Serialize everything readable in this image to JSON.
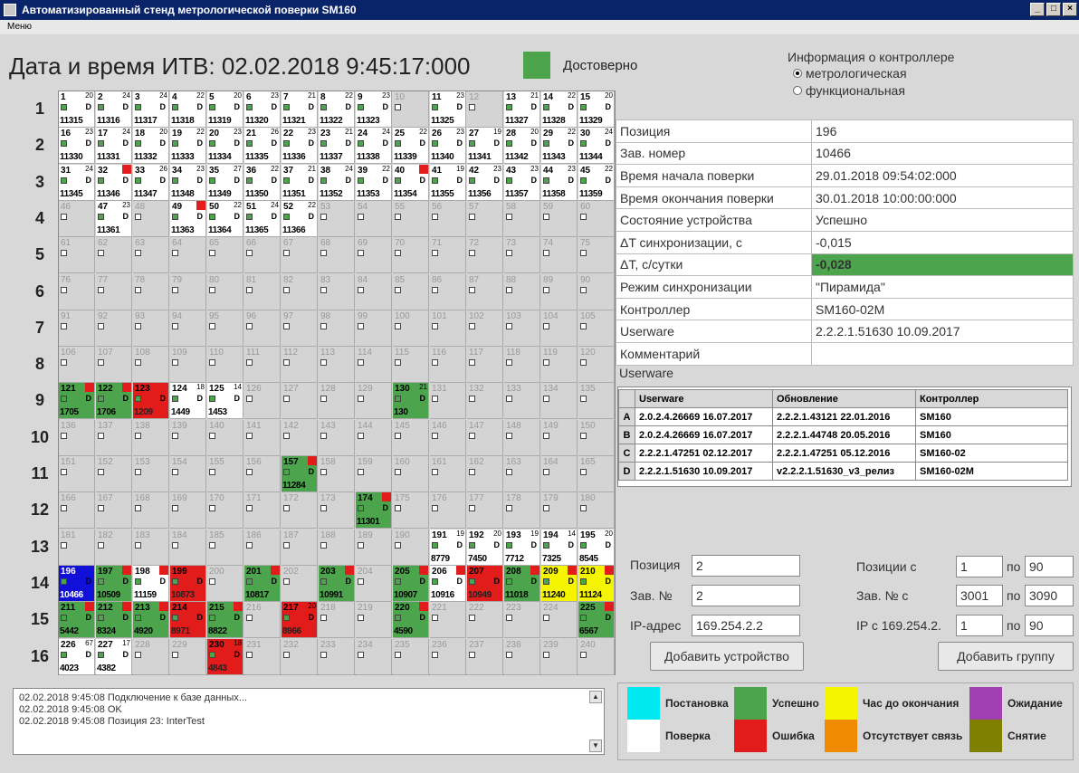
{
  "window": {
    "title": "Автоматизированный стенд метрологической поверки SM160",
    "buttons": [
      "_",
      "□",
      "×"
    ]
  },
  "menu": {
    "label": "Меню"
  },
  "header": {
    "datetime": "Дата и время ИТВ: 02.02.2018 9:45:17:000",
    "reliability": "Достоверно",
    "reliability_color": "#4ca44c"
  },
  "controller_info": {
    "title": "Информация о контроллере",
    "options": [
      {
        "label": "метрологическая",
        "selected": true
      },
      {
        "label": "функциональная",
        "selected": false
      }
    ]
  },
  "rows": [
    "1",
    "2",
    "3",
    "4",
    "5",
    "6",
    "7",
    "8",
    "9",
    "10",
    "11",
    "12",
    "13",
    "14",
    "15",
    "16"
  ],
  "cells": [
    {
      "n": "1",
      "c": "w",
      "s": "11315",
      "t": "20"
    },
    {
      "n": "2",
      "c": "w",
      "s": "11316",
      "t": "24"
    },
    {
      "n": "3",
      "c": "w",
      "s": "11317",
      "t": "24"
    },
    {
      "n": "4",
      "c": "w",
      "s": "11318",
      "t": "22"
    },
    {
      "n": "5",
      "c": "w",
      "s": "11319",
      "t": "20"
    },
    {
      "n": "6",
      "c": "w",
      "s": "11320",
      "t": "23"
    },
    {
      "n": "7",
      "c": "w",
      "s": "11321",
      "t": "21"
    },
    {
      "n": "8",
      "c": "w",
      "s": "11322",
      "t": "22"
    },
    {
      "n": "9",
      "c": "w",
      "s": "11323",
      "t": "23"
    },
    {
      "n": "10",
      "c": "e"
    },
    {
      "n": "11",
      "c": "w",
      "s": "11325",
      "t": "23"
    },
    {
      "n": "12",
      "c": "e"
    },
    {
      "n": "13",
      "c": "w",
      "s": "11327",
      "t": "21"
    },
    {
      "n": "14",
      "c": "w",
      "s": "11328",
      "t": "22"
    },
    {
      "n": "15",
      "c": "w",
      "s": "11329",
      "t": "20"
    },
    {
      "n": "16",
      "c": "w",
      "s": "11330",
      "t": "23"
    },
    {
      "n": "17",
      "c": "w",
      "s": "11331",
      "t": "24"
    },
    {
      "n": "18",
      "c": "w",
      "s": "11332",
      "t": "20"
    },
    {
      "n": "19",
      "c": "w",
      "s": "11333",
      "t": "22"
    },
    {
      "n": "20",
      "c": "w",
      "s": "11334",
      "t": "23"
    },
    {
      "n": "21",
      "c": "w",
      "s": "11335",
      "t": "26"
    },
    {
      "n": "22",
      "c": "w",
      "s": "11336",
      "t": "23"
    },
    {
      "n": "23",
      "c": "w",
      "s": "11337",
      "t": "21"
    },
    {
      "n": "24",
      "c": "w",
      "s": "11338",
      "t": "24"
    },
    {
      "n": "25",
      "c": "w",
      "s": "11339",
      "t": "22"
    },
    {
      "n": "26",
      "c": "w",
      "s": "11340",
      "t": "23"
    },
    {
      "n": "27",
      "c": "w",
      "s": "11341",
      "t": "19"
    },
    {
      "n": "28",
      "c": "w",
      "s": "11342",
      "t": "20"
    },
    {
      "n": "29",
      "c": "w",
      "s": "11343",
      "t": "22"
    },
    {
      "n": "30",
      "c": "w",
      "s": "11344",
      "t": "24"
    },
    {
      "n": "31",
      "c": "w",
      "s": "11345",
      "t": "24"
    },
    {
      "n": "32",
      "c": "w",
      "s": "11346",
      "t": "",
      "f": "r"
    },
    {
      "n": "33",
      "c": "w",
      "s": "11347",
      "t": "26"
    },
    {
      "n": "34",
      "c": "w",
      "s": "11348",
      "t": "23"
    },
    {
      "n": "35",
      "c": "w",
      "s": "11349",
      "t": "27"
    },
    {
      "n": "36",
      "c": "w",
      "s": "11350",
      "t": "22"
    },
    {
      "n": "37",
      "c": "w",
      "s": "11351",
      "t": "21"
    },
    {
      "n": "38",
      "c": "w",
      "s": "11352",
      "t": "24"
    },
    {
      "n": "39",
      "c": "w",
      "s": "11353",
      "t": "22"
    },
    {
      "n": "40",
      "c": "w",
      "s": "11354",
      "t": "",
      "f": "r"
    },
    {
      "n": "41",
      "c": "w",
      "s": "11355",
      "t": "19"
    },
    {
      "n": "42",
      "c": "w",
      "s": "11356",
      "t": "23"
    },
    {
      "n": "43",
      "c": "w",
      "s": "11357",
      "t": "23"
    },
    {
      "n": "44",
      "c": "w",
      "s": "11358",
      "t": "23"
    },
    {
      "n": "45",
      "c": "w",
      "s": "11359",
      "t": "22"
    },
    {
      "n": "46",
      "c": "e"
    },
    {
      "n": "47",
      "c": "w",
      "s": "11361",
      "t": "23"
    },
    {
      "n": "48",
      "c": "e"
    },
    {
      "n": "49",
      "c": "w",
      "s": "11363",
      "t": "",
      "f": "r"
    },
    {
      "n": "50",
      "c": "w",
      "s": "11364",
      "t": "22"
    },
    {
      "n": "51",
      "c": "w",
      "s": "11365",
      "t": "24"
    },
    {
      "n": "52",
      "c": "w",
      "s": "11366",
      "t": "22"
    },
    {
      "n": "53",
      "c": "e"
    },
    {
      "n": "54",
      "c": "e"
    },
    {
      "n": "55",
      "c": "e"
    },
    {
      "n": "56",
      "c": "e"
    },
    {
      "n": "57",
      "c": "e"
    },
    {
      "n": "58",
      "c": "e"
    },
    {
      "n": "59",
      "c": "e"
    },
    {
      "n": "60",
      "c": "e"
    },
    {
      "n": "61",
      "c": "e"
    },
    {
      "n": "62",
      "c": "e"
    },
    {
      "n": "63",
      "c": "e"
    },
    {
      "n": "64",
      "c": "e"
    },
    {
      "n": "65",
      "c": "e"
    },
    {
      "n": "66",
      "c": "e"
    },
    {
      "n": "67",
      "c": "e"
    },
    {
      "n": "68",
      "c": "e"
    },
    {
      "n": "69",
      "c": "e"
    },
    {
      "n": "70",
      "c": "e"
    },
    {
      "n": "71",
      "c": "e"
    },
    {
      "n": "72",
      "c": "e"
    },
    {
      "n": "73",
      "c": "e"
    },
    {
      "n": "74",
      "c": "e"
    },
    {
      "n": "75",
      "c": "e"
    },
    {
      "n": "76",
      "c": "e"
    },
    {
      "n": "77",
      "c": "e"
    },
    {
      "n": "78",
      "c": "e"
    },
    {
      "n": "79",
      "c": "e"
    },
    {
      "n": "80",
      "c": "e"
    },
    {
      "n": "81",
      "c": "e"
    },
    {
      "n": "82",
      "c": "e"
    },
    {
      "n": "83",
      "c": "e"
    },
    {
      "n": "84",
      "c": "e"
    },
    {
      "n": "85",
      "c": "e"
    },
    {
      "n": "86",
      "c": "e"
    },
    {
      "n": "87",
      "c": "e"
    },
    {
      "n": "88",
      "c": "e"
    },
    {
      "n": "89",
      "c": "e"
    },
    {
      "n": "90",
      "c": "e"
    },
    {
      "n": "91",
      "c": "e"
    },
    {
      "n": "92",
      "c": "e"
    },
    {
      "n": "93",
      "c": "e"
    },
    {
      "n": "94",
      "c": "e"
    },
    {
      "n": "95",
      "c": "e"
    },
    {
      "n": "96",
      "c": "e"
    },
    {
      "n": "97",
      "c": "e"
    },
    {
      "n": "98",
      "c": "e"
    },
    {
      "n": "99",
      "c": "e"
    },
    {
      "n": "100",
      "c": "e"
    },
    {
      "n": "101",
      "c": "e"
    },
    {
      "n": "102",
      "c": "e"
    },
    {
      "n": "103",
      "c": "e"
    },
    {
      "n": "104",
      "c": "e"
    },
    {
      "n": "105",
      "c": "e"
    },
    {
      "n": "106",
      "c": "e"
    },
    {
      "n": "107",
      "c": "e"
    },
    {
      "n": "108",
      "c": "e"
    },
    {
      "n": "109",
      "c": "e"
    },
    {
      "n": "110",
      "c": "e"
    },
    {
      "n": "111",
      "c": "e"
    },
    {
      "n": "112",
      "c": "e"
    },
    {
      "n": "113",
      "c": "e"
    },
    {
      "n": "114",
      "c": "e"
    },
    {
      "n": "115",
      "c": "e"
    },
    {
      "n": "116",
      "c": "e"
    },
    {
      "n": "117",
      "c": "e"
    },
    {
      "n": "118",
      "c": "e"
    },
    {
      "n": "119",
      "c": "e"
    },
    {
      "n": "120",
      "c": "e"
    },
    {
      "n": "121",
      "c": "g",
      "s": "1705",
      "f": "r"
    },
    {
      "n": "122",
      "c": "g",
      "s": "1706",
      "f": "r"
    },
    {
      "n": "123",
      "c": "r",
      "s": "1209",
      "f": "r"
    },
    {
      "n": "124",
      "c": "w",
      "s": "1449",
      "t": "18"
    },
    {
      "n": "125",
      "c": "w",
      "s": "1453",
      "t": "14"
    },
    {
      "n": "126",
      "c": "e"
    },
    {
      "n": "127",
      "c": "e"
    },
    {
      "n": "128",
      "c": "e"
    },
    {
      "n": "129",
      "c": "e"
    },
    {
      "n": "130",
      "c": "g",
      "s": "130",
      "t": "21"
    },
    {
      "n": "131",
      "c": "e"
    },
    {
      "n": "132",
      "c": "e"
    },
    {
      "n": "133",
      "c": "e"
    },
    {
      "n": "134",
      "c": "e"
    },
    {
      "n": "135",
      "c": "e"
    },
    {
      "n": "136",
      "c": "e"
    },
    {
      "n": "137",
      "c": "e"
    },
    {
      "n": "138",
      "c": "e"
    },
    {
      "n": "139",
      "c": "e"
    },
    {
      "n": "140",
      "c": "e"
    },
    {
      "n": "141",
      "c": "e"
    },
    {
      "n": "142",
      "c": "e"
    },
    {
      "n": "143",
      "c": "e"
    },
    {
      "n": "144",
      "c": "e"
    },
    {
      "n": "145",
      "c": "e"
    },
    {
      "n": "146",
      "c": "e"
    },
    {
      "n": "147",
      "c": "e"
    },
    {
      "n": "148",
      "c": "e"
    },
    {
      "n": "149",
      "c": "e"
    },
    {
      "n": "150",
      "c": "e"
    },
    {
      "n": "151",
      "c": "e"
    },
    {
      "n": "152",
      "c": "e"
    },
    {
      "n": "153",
      "c": "e"
    },
    {
      "n": "154",
      "c": "e"
    },
    {
      "n": "155",
      "c": "e"
    },
    {
      "n": "156",
      "c": "e"
    },
    {
      "n": "157",
      "c": "g",
      "s": "11284",
      "f": "r"
    },
    {
      "n": "158",
      "c": "e"
    },
    {
      "n": "159",
      "c": "e"
    },
    {
      "n": "160",
      "c": "e"
    },
    {
      "n": "161",
      "c": "e"
    },
    {
      "n": "162",
      "c": "e"
    },
    {
      "n": "163",
      "c": "e"
    },
    {
      "n": "164",
      "c": "e"
    },
    {
      "n": "165",
      "c": "e"
    },
    {
      "n": "166",
      "c": "e"
    },
    {
      "n": "167",
      "c": "e"
    },
    {
      "n": "168",
      "c": "e"
    },
    {
      "n": "169",
      "c": "e"
    },
    {
      "n": "170",
      "c": "e"
    },
    {
      "n": "171",
      "c": "e"
    },
    {
      "n": "172",
      "c": "e"
    },
    {
      "n": "173",
      "c": "e"
    },
    {
      "n": "174",
      "c": "g",
      "s": "11301",
      "f": "r"
    },
    {
      "n": "175",
      "c": "e"
    },
    {
      "n": "176",
      "c": "e"
    },
    {
      "n": "177",
      "c": "e"
    },
    {
      "n": "178",
      "c": "e"
    },
    {
      "n": "179",
      "c": "e"
    },
    {
      "n": "180",
      "c": "e"
    },
    {
      "n": "181",
      "c": "e"
    },
    {
      "n": "182",
      "c": "e"
    },
    {
      "n": "183",
      "c": "e"
    },
    {
      "n": "184",
      "c": "e"
    },
    {
      "n": "185",
      "c": "e"
    },
    {
      "n": "186",
      "c": "e"
    },
    {
      "n": "187",
      "c": "e"
    },
    {
      "n": "188",
      "c": "e"
    },
    {
      "n": "189",
      "c": "e"
    },
    {
      "n": "190",
      "c": "e"
    },
    {
      "n": "191",
      "c": "w",
      "s": "8779",
      "t": "19"
    },
    {
      "n": "192",
      "c": "w",
      "s": "7450",
      "t": "20"
    },
    {
      "n": "193",
      "c": "w",
      "s": "7712",
      "t": "19"
    },
    {
      "n": "194",
      "c": "w",
      "s": "7325",
      "t": "14"
    },
    {
      "n": "195",
      "c": "w",
      "s": "8545",
      "t": "20"
    },
    {
      "n": "196",
      "c": "b",
      "s": "10466"
    },
    {
      "n": "197",
      "c": "g",
      "s": "10509",
      "f": "r"
    },
    {
      "n": "198",
      "c": "w",
      "s": "11159",
      "f": "r"
    },
    {
      "n": "199",
      "c": "r",
      "s": "10873",
      "f": "r"
    },
    {
      "n": "200",
      "c": "e"
    },
    {
      "n": "201",
      "c": "g",
      "s": "10817",
      "f": "r"
    },
    {
      "n": "202",
      "c": "e"
    },
    {
      "n": "203",
      "c": "g",
      "s": "10991",
      "f": "r"
    },
    {
      "n": "204",
      "c": "e"
    },
    {
      "n": "205",
      "c": "g",
      "s": "10907",
      "f": "r"
    },
    {
      "n": "206",
      "c": "w",
      "s": "10916",
      "f": "r"
    },
    {
      "n": "207",
      "c": "r",
      "s": "10949",
      "f": "r"
    },
    {
      "n": "208",
      "c": "g",
      "s": "11018",
      "f": "r"
    },
    {
      "n": "209",
      "c": "y",
      "s": "11240",
      "f": "r"
    },
    {
      "n": "210",
      "c": "y",
      "s": "11124",
      "f": "r"
    },
    {
      "n": "211",
      "c": "g",
      "s": "5442",
      "f": "r"
    },
    {
      "n": "212",
      "c": "g",
      "s": "8324",
      "f": "r"
    },
    {
      "n": "213",
      "c": "g",
      "s": "4920",
      "f": "r"
    },
    {
      "n": "214",
      "c": "r",
      "s": "8971",
      "f": "r"
    },
    {
      "n": "215",
      "c": "g",
      "s": "8822",
      "f": "r"
    },
    {
      "n": "216",
      "c": "e"
    },
    {
      "n": "217",
      "c": "r",
      "s": "8966",
      "t": "20"
    },
    {
      "n": "218",
      "c": "e"
    },
    {
      "n": "219",
      "c": "e"
    },
    {
      "n": "220",
      "c": "g",
      "s": "4590",
      "f": "r"
    },
    {
      "n": "221",
      "c": "e"
    },
    {
      "n": "222",
      "c": "e"
    },
    {
      "n": "223",
      "c": "e"
    },
    {
      "n": "224",
      "c": "e"
    },
    {
      "n": "225",
      "c": "g",
      "s": "6567",
      "f": "r"
    },
    {
      "n": "226",
      "c": "w",
      "s": "4023",
      "t": "67"
    },
    {
      "n": "227",
      "c": "w",
      "s": "4382",
      "t": "17"
    },
    {
      "n": "228",
      "c": "e"
    },
    {
      "n": "229",
      "c": "e"
    },
    {
      "n": "230",
      "c": "r",
      "s": "4843",
      "t": "18"
    },
    {
      "n": "231",
      "c": "e"
    },
    {
      "n": "232",
      "c": "e"
    },
    {
      "n": "233",
      "c": "e"
    },
    {
      "n": "234",
      "c": "e"
    },
    {
      "n": "235",
      "c": "e"
    },
    {
      "n": "236",
      "c": "e"
    },
    {
      "n": "237",
      "c": "e"
    },
    {
      "n": "238",
      "c": "e"
    },
    {
      "n": "239",
      "c": "e"
    },
    {
      "n": "240",
      "c": "e"
    }
  ],
  "properties": [
    {
      "k": "Позиция",
      "v": "196"
    },
    {
      "k": "Зав. номер",
      "v": "10466"
    },
    {
      "k": "Время начала поверки",
      "v": "29.01.2018 09:54:02:000"
    },
    {
      "k": "Время окончания поверки",
      "v": "30.01.2018 10:00:00:000"
    },
    {
      "k": "Состояние устройства",
      "v": "Успешно"
    },
    {
      "k": "ΔT синхронизации, с",
      "v": "-0,015"
    },
    {
      "k": "ΔT, с/сутки",
      "v": "-0,028",
      "highlight": true
    },
    {
      "k": "Режим синхронизации",
      "v": "\"Пирамида\""
    },
    {
      "k": "Контроллер",
      "v": "SM160-02M"
    },
    {
      "k": "Userware",
      "v": "2.2.2.1.51630 10.09.2017"
    },
    {
      "k": "Комментарий",
      "v": ""
    }
  ],
  "userware": {
    "label": "Userware",
    "headers": [
      "Userware",
      "Обновление",
      "Контроллер"
    ],
    "rows": [
      {
        "r": "A",
        "uw": "2.0.2.4.26669 16.07.2017",
        "up": "2.2.2.1.43121 22.01.2016",
        "c": "SM160"
      },
      {
        "r": "B",
        "uw": "2.0.2.4.26669 16.07.2017",
        "up": "2.2.2.1.44748 20.05.2016",
        "c": "SM160"
      },
      {
        "r": "C",
        "uw": "2.2.2.1.47251 02.12.2017",
        "up": "2.2.2.1.47251 05.12.2016",
        "c": "SM160-02"
      },
      {
        "r": "D",
        "uw": "2.2.2.1.51630 10.09.2017",
        "up": "v2.2.2.1.51630_v3_релиз",
        "c": "SM160-02M"
      }
    ]
  },
  "add_device": {
    "pos_label": "Позиция",
    "pos": "2",
    "serial_label": "Зав. №",
    "serial": "2",
    "ip_label": "IP-адрес",
    "ip": "169.254.2.2",
    "button": "Добавить устройство"
  },
  "add_group": {
    "pos_label": "Позиции с",
    "pos_from": "1",
    "to1": "по",
    "pos_to": "90",
    "serial_label": "Зав. № с",
    "serial_from": "3001",
    "to2": "по",
    "serial_to": "3090",
    "ip_label": "IP с 169.254.2.",
    "ip_from": "1",
    "to3": "по",
    "ip_to": "90",
    "button": "Добавить группу"
  },
  "log": [
    "02.02.2018 9:45:08  Подключение к базе данных...",
    "02.02.2018 9:45:08  OK",
    "02.02.2018 9:45:08  Позиция 23: InterTest"
  ],
  "legend": [
    {
      "label": "Постановка",
      "color": "#00e8f0"
    },
    {
      "label": "Успешно",
      "color": "#4ca44c"
    },
    {
      "label": "Час до окончания",
      "color": "#f5f500"
    },
    {
      "label": "Ожидание",
      "color": "#a040b0"
    },
    {
      "label": "Поверка",
      "color": "#ffffff"
    },
    {
      "label": "Ошибка",
      "color": "#e21b1b"
    },
    {
      "label": "Отсутствует связь",
      "color": "#f08a00"
    },
    {
      "label": "Снятие",
      "color": "#808000"
    }
  ]
}
